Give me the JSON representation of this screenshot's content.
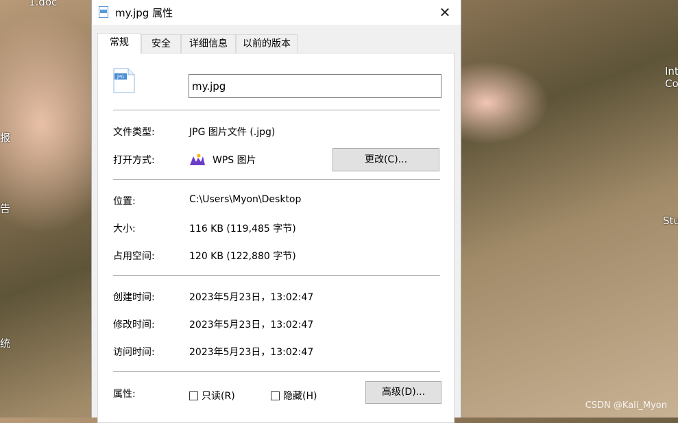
{
  "desktop": {
    "items": [
      "1.doc",
      "报",
      "告",
      "Intel Core",
      "Stu",
      "统"
    ]
  },
  "dialog": {
    "title": "my.jpg 属性",
    "tabs": [
      "常规",
      "安全",
      "详细信息",
      "以前的版本"
    ],
    "file_name": "my.jpg",
    "file_type_label": "文件类型:",
    "file_type_value": "JPG 图片文件 (.jpg)",
    "open_with_label": "打开方式:",
    "open_with_value": "WPS 图片",
    "change_button": "更改(C)...",
    "location_label": "位置:",
    "location_value": "C:\\Users\\Myon\\Desktop",
    "size_label": "大小:",
    "size_value": "116 KB (119,485 字节)",
    "size_on_disk_label": "占用空间:",
    "size_on_disk_value": "120 KB (122,880 字节)",
    "created_label": "创建时间:",
    "created_value": "2023年5月23日，13:02:47",
    "modified_label": "修改时间:",
    "modified_value": "2023年5月23日，13:02:47",
    "accessed_label": "访问时间:",
    "accessed_value": "2023年5月23日，13:02:47",
    "attributes_label": "属性:",
    "readonly_label": "只读(R)",
    "hidden_label": "隐藏(H)",
    "advanced_button": "高级(D)..."
  },
  "watermark": "CSDN @Kali_Myon",
  "colors": {
    "accent": "#5a9bd6",
    "wps": "#6a3cc8"
  }
}
